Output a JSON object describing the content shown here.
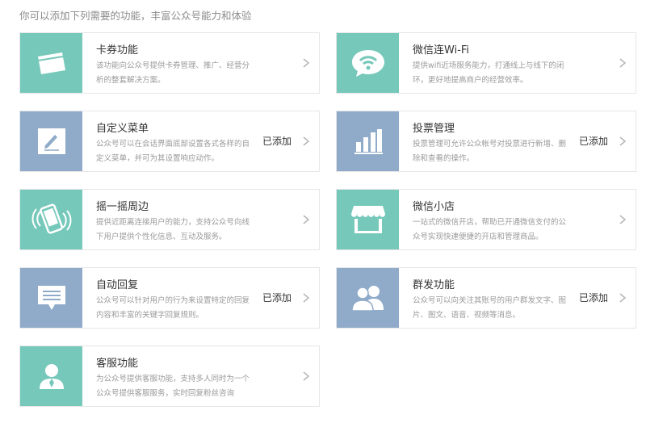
{
  "header": "你可以添加下列需要的功能，丰富公众号能力和体验",
  "features": [
    {
      "id": "card",
      "title": "卡券功能",
      "desc": "该功能向公众号提供卡券管理、推广、经营分析的整套解决方案。",
      "status": "",
      "color": "teal",
      "icon": "card-icon"
    },
    {
      "id": "wifi",
      "title": "微信连Wi-Fi",
      "desc": "提供wifi近场服务能力，打通线上与线下的闭环，更好地提高商户的经营效率。",
      "status": "",
      "color": "teal",
      "icon": "wifi-chat-icon"
    },
    {
      "id": "menu",
      "title": "自定义菜单",
      "desc": "公众号可以在会话界面底部设置各式各样的自定义菜单，并可为其设置响应动作。",
      "status": "已添加",
      "color": "blue",
      "icon": "pencil-icon"
    },
    {
      "id": "vote",
      "title": "投票管理",
      "desc": "投票管理可允许公众帐号对投票进行新增、删除和查看的操作。",
      "status": "已添加",
      "color": "blue",
      "icon": "bar-chart-icon"
    },
    {
      "id": "shake",
      "title": "摇一摇周边",
      "desc": "提供近距离连接用户的能力，支持公众号向线下用户提供个性化信息、互动及服务。",
      "status": "",
      "color": "teal",
      "icon": "shake-phone-icon"
    },
    {
      "id": "shop",
      "title": "微信小店",
      "desc": "一站式的微信开店，帮助已开通微信支付的公众号实现快速便捷的开店和管理商品。",
      "status": "",
      "color": "teal",
      "icon": "storefront-icon"
    },
    {
      "id": "reply",
      "title": "自动回复",
      "desc": "公众号可以针对用户的行为来设置特定的回复内容和丰富的关键字回复规则。",
      "status": "已添加",
      "color": "blue",
      "icon": "message-icon"
    },
    {
      "id": "mass",
      "title": "群发功能",
      "desc": "公众号可以向关注其账号的用户群发文字、图片、图文、语音、视频等消息。",
      "status": "已添加",
      "color": "blue",
      "icon": "users-icon"
    },
    {
      "id": "service",
      "title": "客服功能",
      "desc": "为公众号提供客服功能，支持多人同时为一个公众号提供客服服务，实时回复粉丝咨询",
      "status": "",
      "color": "teal",
      "icon": "agent-icon"
    }
  ]
}
